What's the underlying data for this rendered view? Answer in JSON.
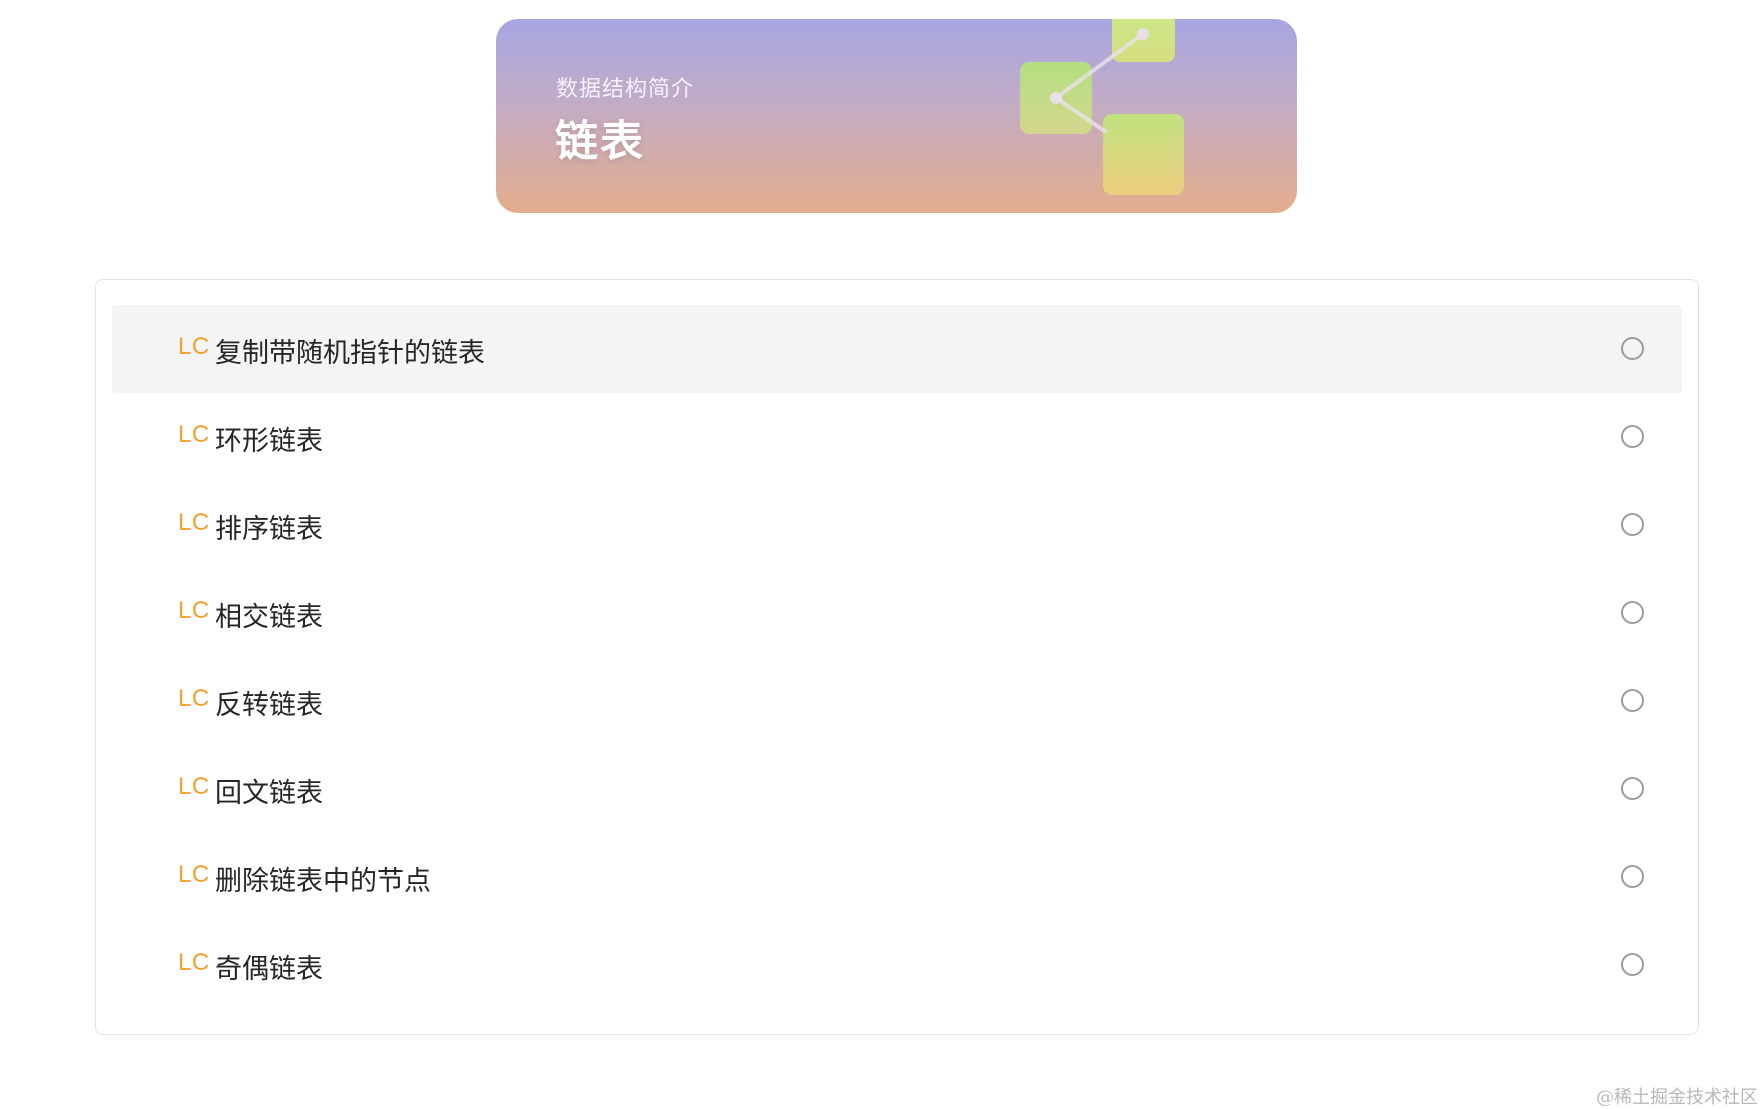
{
  "banner": {
    "subtitle": "数据结构简介",
    "title": "链表",
    "illustration": "linked-nodes-illustration"
  },
  "list": {
    "prefix": "LC",
    "items": [
      {
        "label": "复制带随机指针的链表",
        "checked": false,
        "active": true
      },
      {
        "label": "环形链表",
        "checked": false,
        "active": false
      },
      {
        "label": "排序链表",
        "checked": false,
        "active": false
      },
      {
        "label": "相交链表",
        "checked": false,
        "active": false
      },
      {
        "label": "反转链表",
        "checked": false,
        "active": false
      },
      {
        "label": "回文链表",
        "checked": false,
        "active": false
      },
      {
        "label": "删除链表中的节点",
        "checked": false,
        "active": false
      },
      {
        "label": "奇偶链表",
        "checked": false,
        "active": false
      }
    ]
  },
  "watermark": "@稀土掘金技术社区",
  "colors": {
    "prefix": "#f0a030",
    "active_row": "#f4f4f4",
    "banner_top": "#a6a6e2",
    "banner_bottom": "#e3ad8a"
  }
}
